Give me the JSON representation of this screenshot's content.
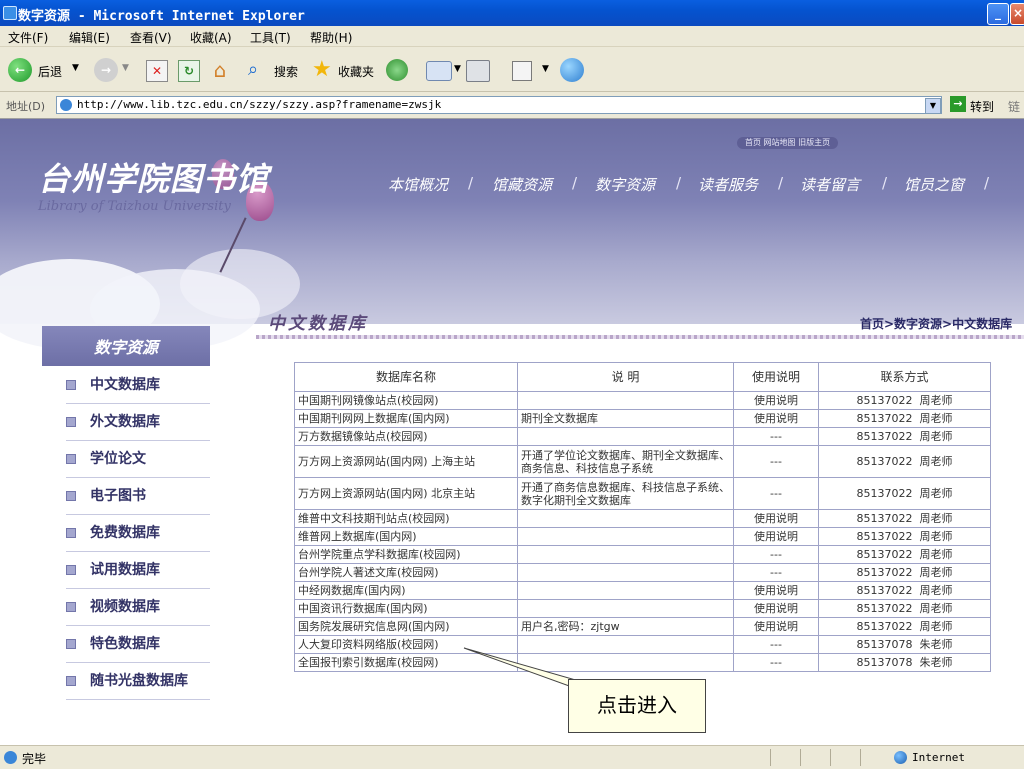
{
  "window": {
    "title": "数字资源 - Microsoft Internet Explorer",
    "min_label": "_",
    "close_label": "×"
  },
  "menu": {
    "items": [
      "文件(F)",
      "编辑(E)",
      "查看(V)",
      "收藏(A)",
      "工具(T)",
      "帮助(H)"
    ]
  },
  "toolbar": {
    "back_label": "后退",
    "search_label": "搜索",
    "favorites_label": "收藏夹"
  },
  "address": {
    "label": "地址(D)",
    "url": "http://www.lib.tzc.edu.cn/szzy/szzy.asp?framename=zwsjk",
    "go_label": "转到",
    "links_label": "链"
  },
  "site": {
    "title": "台州学院图书馆",
    "subtitle": "Library of Taizhou University",
    "top_links": "首页  网站地图  旧版主页",
    "nav": [
      "本馆概况",
      "馆藏资源",
      "数字资源",
      "读者服务",
      "读者留言",
      "馆员之窗"
    ]
  },
  "sidebar": {
    "header": "数字资源",
    "items": [
      "中文数据库",
      "外文数据库",
      "学位论文",
      "电子图书",
      "免费数据库",
      "试用数据库",
      "视频数据库",
      "特色数据库",
      "随书光盘数据库"
    ]
  },
  "content": {
    "section_title": "中文数据库",
    "breadcrumb": "首页>数字资源>中文数据库",
    "table": {
      "headers": [
        "数据库名称",
        "说  明",
        "使用说明",
        "联系方式"
      ],
      "rows": [
        {
          "name": "中国期刊网镜像站点(校园网)",
          "desc": "",
          "usage": "使用说明",
          "phone": "85137022",
          "contact": "周老师"
        },
        {
          "name": "中国期刊网网上数据库(国内网)",
          "desc": "期刊全文数据库",
          "usage": "使用说明",
          "phone": "85137022",
          "contact": "周老师"
        },
        {
          "name": "万方数据镜像站点(校园网)",
          "desc": "",
          "usage": "---",
          "phone": "85137022",
          "contact": "周老师"
        },
        {
          "name": "万方网上资源网站(国内网) 上海主站",
          "desc": "开通了学位论文数据库、期刊全文数据库、商务信息、科技信息子系统",
          "usage": "---",
          "phone": "85137022",
          "contact": "周老师"
        },
        {
          "name": "万方网上资源网站(国内网) 北京主站",
          "desc": "开通了商务信息数据库、科技信息子系统、数字化期刊全文数据库",
          "usage": "---",
          "phone": "85137022",
          "contact": "周老师"
        },
        {
          "name": "维普中文科技期刊站点(校园网)",
          "desc": "",
          "usage": "使用说明",
          "phone": "85137022",
          "contact": "周老师"
        },
        {
          "name": "维普网上数据库(国内网)",
          "desc": "",
          "usage": "使用说明",
          "phone": "85137022",
          "contact": "周老师"
        },
        {
          "name": "台州学院重点学科数据库(校园网)",
          "desc": "",
          "usage": "---",
          "phone": "85137022",
          "contact": "周老师"
        },
        {
          "name": "台州学院人著述文库(校园网)",
          "desc": "",
          "usage": "---",
          "phone": "85137022",
          "contact": "周老师"
        },
        {
          "name": "中经网数据库(国内网)",
          "desc": "",
          "usage": "使用说明",
          "phone": "85137022",
          "contact": "周老师"
        },
        {
          "name": "中国资讯行数据库(国内网)",
          "desc": "",
          "usage": "使用说明",
          "phone": "85137022",
          "contact": "周老师"
        },
        {
          "name": "国务院发展研究信息网(国内网)",
          "desc": "用户名,密码：zjtgw",
          "usage": "使用说明",
          "phone": "85137022",
          "contact": "周老师"
        },
        {
          "name": "人大复印资料网络版(校园网)",
          "desc": "",
          "usage": "---",
          "phone": "85137078",
          "contact": "朱老师"
        },
        {
          "name": "全国报刊索引数据库(校园网)",
          "desc": "",
          "usage": "---",
          "phone": "85137078",
          "contact": "朱老师"
        }
      ]
    }
  },
  "callout": {
    "text": "点击进入"
  },
  "status": {
    "text": "完毕",
    "zone": "Internet"
  },
  "colors": {
    "titlebar_blue": "#0553cf",
    "chrome_bg": "#ece9d8",
    "banner_purple": "#7f82b5",
    "sidebar_text": "#333366"
  }
}
